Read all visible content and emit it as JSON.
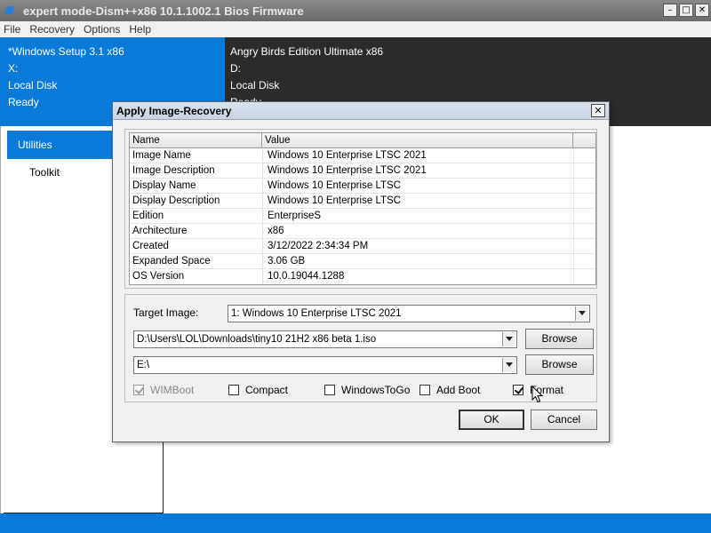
{
  "window": {
    "title": "expert mode-Dism++x86 10.1.1002.1 Bios Firmware",
    "minimize_glyph": "–",
    "maximize_glyph": "□",
    "close_glyph": "✕"
  },
  "menu": [
    "File",
    "Recovery",
    "Options",
    "Help"
  ],
  "left_image": {
    "name": "*Windows Setup 3.1 x86",
    "drive": "X:",
    "disk": "Local Disk",
    "status": "Ready"
  },
  "right_image": {
    "name": "Angry Birds Edition Ultimate x86",
    "drive": "D:",
    "disk": "Local Disk",
    "status": "Ready"
  },
  "sidebar": {
    "items": [
      "Utilities",
      "Toolkit"
    ]
  },
  "dialog": {
    "title": "Apply Image-Recovery",
    "close_glyph": "✕",
    "columns": [
      "Name",
      "Value"
    ],
    "rows": [
      [
        "Image Name",
        "Windows 10 Enterprise LTSC 2021"
      ],
      [
        "Image Description",
        "Windows 10 Enterprise LTSC 2021"
      ],
      [
        "Display Name",
        "Windows 10 Enterprise LTSC"
      ],
      [
        "Display Description",
        "Windows 10 Enterprise LTSC"
      ],
      [
        "Edition",
        "EnterpriseS"
      ],
      [
        "Architecture",
        "x86"
      ],
      [
        "Created",
        "3/12/2022 2:34:34 PM"
      ],
      [
        "Expanded Space",
        "3.06 GB"
      ],
      [
        "OS Version",
        "10.0.19044.1288"
      ]
    ],
    "target_image_label": "Target Image:",
    "target_image_value": "1: Windows 10 Enterprise LTSC 2021",
    "source_path": "D:\\Users\\LOL\\Downloads\\tiny10 21H2 x86 beta 1.iso",
    "target_path": "E:\\",
    "browse_label": "Browse",
    "checkboxes": [
      {
        "label": "WIMBoot",
        "checked": true,
        "disabled": true
      },
      {
        "label": "Compact",
        "checked": false,
        "disabled": false
      },
      {
        "label": "WindowsToGo",
        "checked": false,
        "disabled": false
      },
      {
        "label": "Add Boot",
        "checked": false,
        "disabled": false
      },
      {
        "label": "Format",
        "checked": true,
        "disabled": false
      }
    ],
    "ok_label": "OK",
    "cancel_label": "Cancel"
  },
  "colors": {
    "accent": "#0a7ad8",
    "dark_panel": "#2b2b2b",
    "dialog_bg": "#f0f0f0"
  }
}
